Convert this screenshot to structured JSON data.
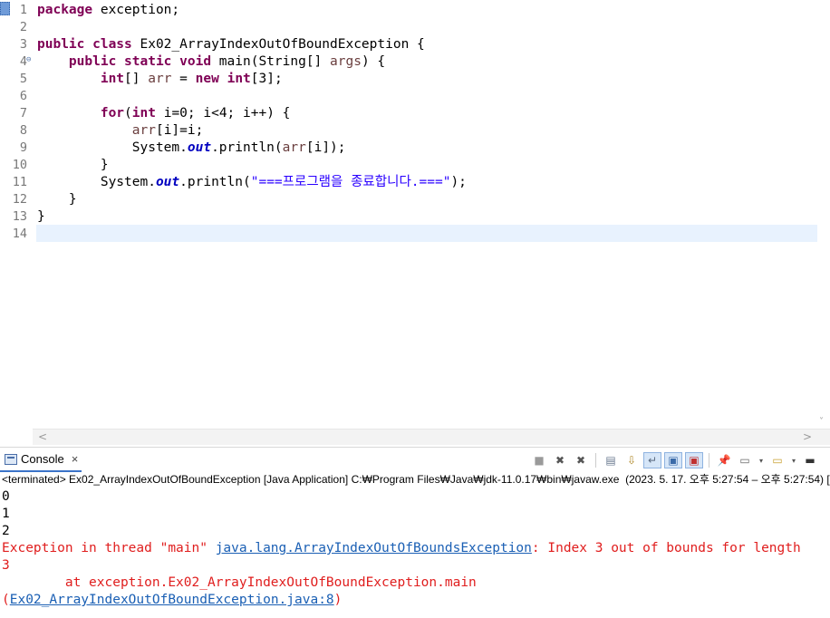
{
  "editor": {
    "line_numbers": [
      "1",
      "2",
      "3",
      "4",
      "5",
      "6",
      "7",
      "8",
      "9",
      "10",
      "11",
      "12",
      "13",
      "14"
    ],
    "fold_marker": "⊖",
    "code": {
      "l1_kw": "package",
      "l1_rest": " exception;",
      "l3_kw": "public class",
      "l3_rest": " Ex02_ArrayIndexOutOfBoundException {",
      "l4_indent": "    ",
      "l4_kw": "public static void",
      "l4_mid": " main(String[] ",
      "l4_var": "args",
      "l4_end": ") {",
      "l5_indent": "        ",
      "l5_kw1": "int",
      "l5_mid1": "[] ",
      "l5_var": "arr",
      "l5_mid2": " = ",
      "l5_kw2": "new",
      "l5_sp": " ",
      "l5_kw3": "int",
      "l5_end": "[3];",
      "l7_indent": "        ",
      "l7_kw1": "for",
      "l7_p": "(",
      "l7_kw2": "int",
      "l7_rest": " i=0; i<4; i++) {",
      "l8_indent": "            ",
      "l8_var": "arr",
      "l8_rest": "[i]=i;",
      "l9_indent": "            ",
      "l9_a": "System.",
      "l9_fld": "out",
      "l9_b": ".println(",
      "l9_var": "arr",
      "l9_c": "[i]);",
      "l10": "        }",
      "l11_indent": "        ",
      "l11_a": "System.",
      "l11_fld": "out",
      "l11_b": ".println(",
      "l11_str": "\"===프로그램을 종료합니다.===\"",
      "l11_c": ");",
      "l12": "    }",
      "l13": "}"
    },
    "hscroll_left": "<",
    "hscroll_right": ">",
    "vscroll_down": "˅"
  },
  "console": {
    "tab_label": "Console",
    "tab_close": "×",
    "terminated_line": "<terminated> Ex02_ArrayIndexOutOfBoundException [Java Application] C:₩Program Files₩Java₩jdk-11.0.17₩bin₩javaw.exe  (2023. 5. 17. 오후 5:27:54 – 오후 5:27:54) [",
    "output": {
      "line1": "0",
      "line2": "1",
      "line3": "2",
      "exc_prefix": "Exception in thread \"main\" ",
      "exc_link": "java.lang.ArrayIndexOutOfBoundsException",
      "exc_suffix": ": Index 3 out of bounds for length",
      "exc_cont": "3",
      "at_line": "        at exception.Ex02_ArrayIndexOutOfBoundException.main",
      "paren_open": "(",
      "src_link": "Ex02_ArrayIndexOutOfBoundException.java:8",
      "paren_close": ")"
    },
    "toolbar_icons": {
      "terminate": "■",
      "remove": "✖",
      "remove_all": "✖",
      "clear": "▤",
      "scroll_lock": "⇩",
      "word_wrap": "↵",
      "show_out": "▣",
      "show_err": "▣",
      "pin": "📌",
      "display": "▭",
      "dropdown": "▾",
      "new_console": "▭",
      "minimize": "▬"
    }
  }
}
